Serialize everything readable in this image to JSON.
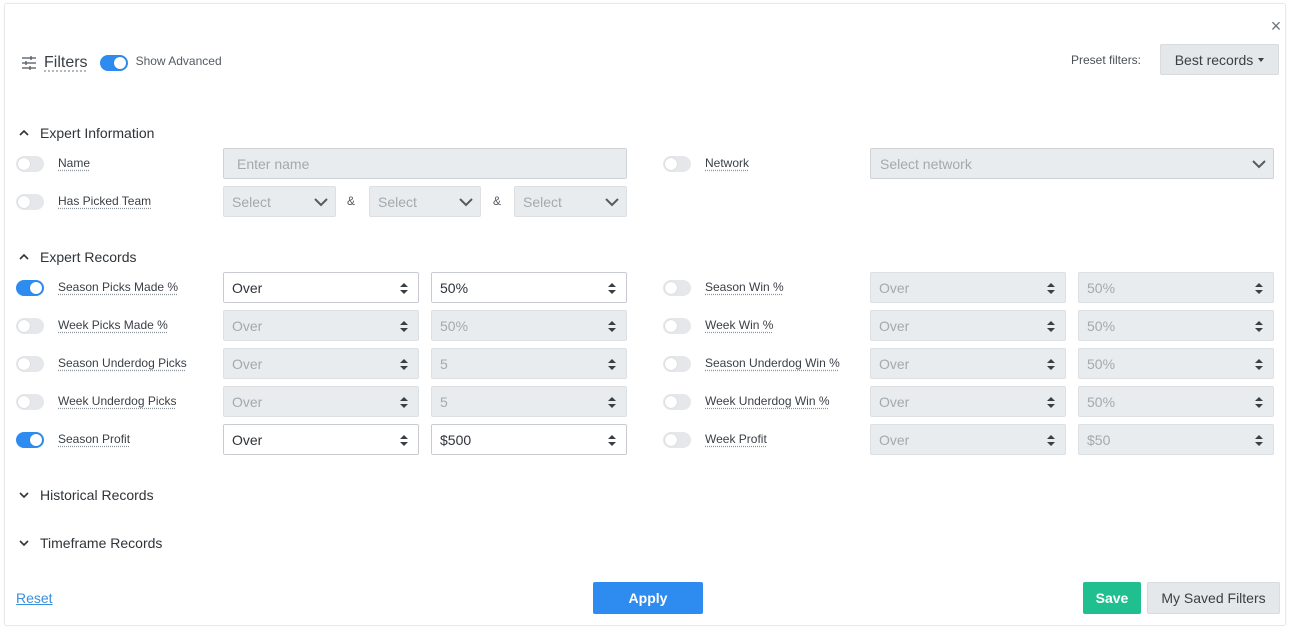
{
  "header": {
    "title": "Filters",
    "show_advanced": {
      "label": "Show Advanced",
      "on": true
    },
    "preset_label": "Preset filters:",
    "preset_value": "Best records"
  },
  "sections": {
    "expert_info": {
      "title": "Expert Information",
      "expanded": true
    },
    "expert_records": {
      "title": "Expert Records",
      "expanded": true
    },
    "historical_records": {
      "title": "Historical Records",
      "expanded": false
    },
    "timeframe_records": {
      "title": "Timeframe Records",
      "expanded": false
    }
  },
  "expert_info": {
    "name": {
      "label": "Name",
      "placeholder": "Enter name",
      "on": false
    },
    "network": {
      "label": "Network",
      "placeholder": "Select network",
      "on": false
    },
    "picked_team": {
      "label": "Has Picked Team",
      "on": false,
      "selects": [
        "Select",
        "Select",
        "Select"
      ],
      "joiner": "&"
    }
  },
  "records_left": [
    {
      "label": "Season Picks Made %",
      "on": true,
      "op": "Over",
      "value": "50%"
    },
    {
      "label": "Week Picks Made %",
      "on": false,
      "op": "Over",
      "value": "50%"
    },
    {
      "label": "Season Underdog Picks",
      "on": false,
      "op": "Over",
      "value": "5"
    },
    {
      "label": "Week Underdog Picks",
      "on": false,
      "op": "Over",
      "value": "5"
    },
    {
      "label": "Season Profit",
      "on": true,
      "op": "Over",
      "value": "$500"
    }
  ],
  "records_right": [
    {
      "label": "Season Win %",
      "on": false,
      "op": "Over",
      "value": "50%"
    },
    {
      "label": "Week Win %",
      "on": false,
      "op": "Over",
      "value": "50%"
    },
    {
      "label": "Season Underdog Win %",
      "on": false,
      "op": "Over",
      "value": "50%"
    },
    {
      "label": "Week Underdog Win %",
      "on": false,
      "op": "Over",
      "value": "50%"
    },
    {
      "label": "Week Profit",
      "on": false,
      "op": "Over",
      "value": "$50"
    }
  ],
  "footer": {
    "reset": "Reset",
    "apply": "Apply",
    "save": "Save",
    "saved_filters": "My Saved Filters"
  },
  "colors": {
    "accent": "#2e8bef",
    "save": "#1fbf8f",
    "disabled_bg": "#e9ecef"
  }
}
